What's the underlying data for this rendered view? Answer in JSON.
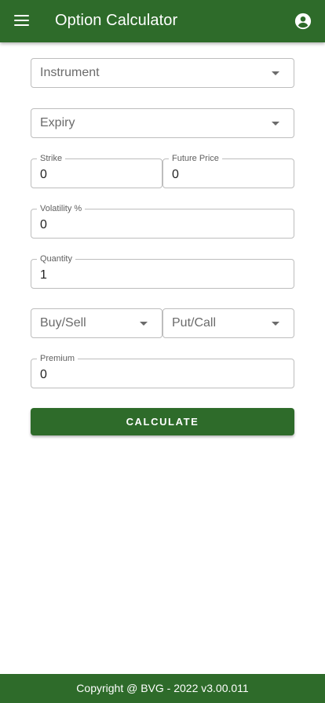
{
  "app": {
    "title": "Option Calculator"
  },
  "icons": {
    "menu": "hamburger-menu-icon",
    "account": "account-circle-icon",
    "dropdown": "arrow-drop-down-icon"
  },
  "colors": {
    "primary": "#2e6b2a",
    "border": "#bdbdbd"
  },
  "form": {
    "instrument": {
      "placeholder": "Instrument"
    },
    "expiry": {
      "placeholder": "Expiry"
    },
    "strike": {
      "label": "Strike",
      "value": "0"
    },
    "future_price": {
      "label": "Future Price",
      "value": "0"
    },
    "volatility": {
      "label": "Volatility %",
      "value": "0"
    },
    "quantity": {
      "label": "Quantity",
      "value": "1"
    },
    "buy_sell": {
      "placeholder": "Buy/Sell"
    },
    "put_call": {
      "placeholder": "Put/Call"
    },
    "premium": {
      "label": "Premium",
      "value": "0"
    },
    "calculate_label": "CALCULATE"
  },
  "footer": {
    "text": "Copyright @ BVG - 2022 v3.00.011"
  }
}
